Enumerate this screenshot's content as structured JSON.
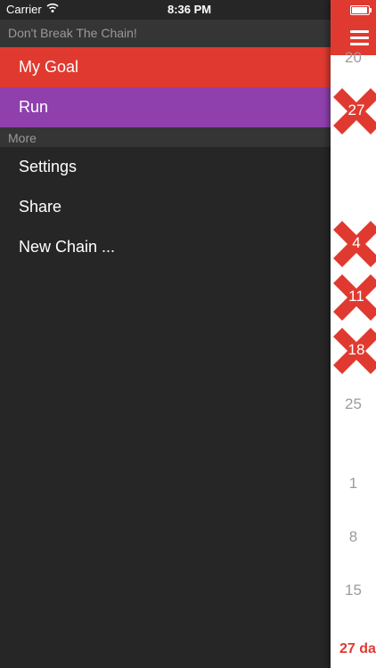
{
  "status_bar": {
    "carrier": "Carrier",
    "time": "8:36 PM"
  },
  "menu": {
    "header": "Don't Break The Chain!",
    "goal": "My Goal",
    "chain": "Run",
    "section": "More",
    "settings": "Settings",
    "share": "Share",
    "new_chain": "New Chain ..."
  },
  "calendar": {
    "days": [
      {
        "label": "20",
        "marked": false
      },
      {
        "label": "27",
        "marked": true
      },
      {
        "label": "4",
        "marked": true
      },
      {
        "label": "11",
        "marked": true
      },
      {
        "label": "18",
        "marked": true
      },
      {
        "label": "25",
        "marked": false
      },
      {
        "label": "1",
        "marked": false
      },
      {
        "label": "8",
        "marked": false
      },
      {
        "label": "15",
        "marked": false
      }
    ],
    "counter": "27 da"
  },
  "colors": {
    "accent": "#e03a30",
    "chain": "#8f40ad",
    "background": "#262626"
  },
  "icons": [
    "wifi-icon",
    "battery-icon",
    "hamburger-icon",
    "x-mark-icon"
  ]
}
